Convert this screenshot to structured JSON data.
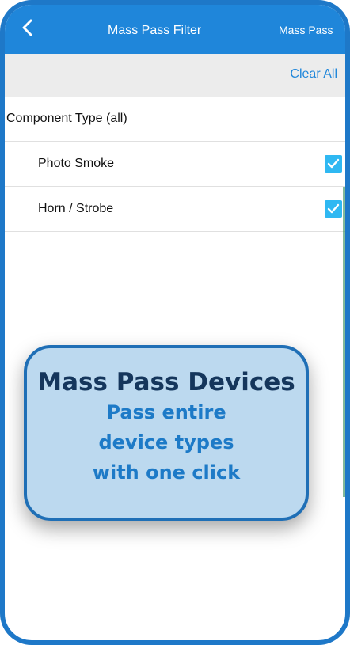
{
  "nav": {
    "back_icon": "chevron-left-icon",
    "title": "Mass Pass Filter",
    "right_label": "Mass Pass"
  },
  "toolbar": {
    "clear_all_label": "Clear All"
  },
  "filter": {
    "section_title": "Component Type (all)",
    "items": [
      {
        "label": "Photo Smoke",
        "checked": true
      },
      {
        "label": "Horn / Strobe",
        "checked": true
      }
    ]
  },
  "callout": {
    "title": "Mass Pass Devices",
    "lines": [
      "Pass entire",
      "device types",
      "with one click"
    ]
  },
  "colors": {
    "nav_bar": "#1f86da",
    "checkbox": "#2fb8f2",
    "callout_bg": "#bcd9ef",
    "callout_border": "#1f6fb6",
    "callout_title": "#15365c",
    "callout_text": "#1d7ac7"
  }
}
